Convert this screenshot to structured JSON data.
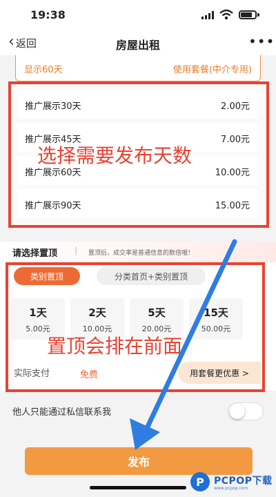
{
  "status_bar": {
    "time": "19:38"
  },
  "nav": {
    "back_label": "返回",
    "title": "房屋出租",
    "more_icon": "more-dots-icon"
  },
  "package_card": {
    "left": "显示60天",
    "right": "使用套餐(中介专用)"
  },
  "promotions": [
    {
      "label": "推广展示30天",
      "price": "2.00元"
    },
    {
      "label": "推广展示45天",
      "price": "7.00元"
    },
    {
      "label": "推广展示60天",
      "price": "10.00元"
    },
    {
      "label": "推广展示90天",
      "price": "15.00元"
    }
  ],
  "annotations": {
    "days": "选择需要发布天数",
    "pin": "置顶会排在前面"
  },
  "pin": {
    "heading": "请选择置顶",
    "separator": "|",
    "hint": "置顶后，成交率是普通信息的数倍哦！",
    "tabs": [
      "类别置顶",
      "分类首页+类别置顶"
    ],
    "active_tab": 0,
    "options": [
      {
        "days": "1天",
        "price": "5.00元"
      },
      {
        "days": "2天",
        "price": "10.00元"
      },
      {
        "days": "5天",
        "price": "20.00元"
      },
      {
        "days": "15天",
        "price": "50.00元"
      }
    ],
    "pay_label": "实际支付",
    "pay_value": "免费",
    "package_button": "用套餐更优惠 >"
  },
  "private_contact": {
    "label": "他人只能通过私信联系我",
    "enabled": false
  },
  "publish_button": "发布",
  "watermark": {
    "logo": "P",
    "name": "PCPOP下载",
    "url": "www.pcpop.com"
  },
  "colors": {
    "accent": "#ee6a35",
    "annotation_red": "#e84232",
    "arrow_blue": "#2f7de1",
    "publish": "#f19a42"
  }
}
